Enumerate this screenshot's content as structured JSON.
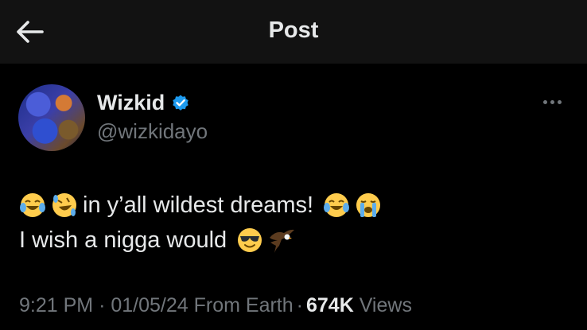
{
  "header": {
    "title": "Post"
  },
  "author": {
    "name": "Wizkid",
    "handle": "@wizkidayo",
    "verified_color": "#1d9bf0"
  },
  "tweet": {
    "line1_text": "in y’all wildest dreams!",
    "line2_text": "I wish a nigga would",
    "line1_emojis_before": [
      "face-with-tears-of-joy-icon",
      "rolling-on-floor-laughing-icon"
    ],
    "line1_emojis_after": [
      "face-with-tears-of-joy-icon",
      "loudly-crying-face-icon"
    ],
    "line2_emojis_after": [
      "smiling-face-with-sunglasses-icon",
      "eagle-icon"
    ]
  },
  "meta": {
    "time": "9:21 PM",
    "date": "01/05/24",
    "source": "From Earth",
    "views_count": "674K",
    "views_label": "Views",
    "separator": "·"
  }
}
